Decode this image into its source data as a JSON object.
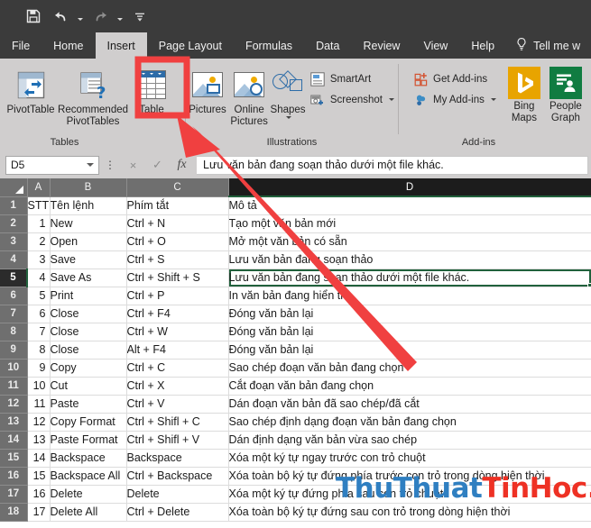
{
  "quick_access": {
    "buttons": [
      {
        "name": "save-icon",
        "label": "Save"
      },
      {
        "name": "undo-icon",
        "label": "Undo"
      },
      {
        "name": "redo-icon",
        "label": "Redo"
      },
      {
        "name": "customize-qat-icon",
        "label": "Customize Quick Access Toolbar"
      }
    ]
  },
  "ribbon": {
    "tabs": [
      {
        "label": "File",
        "active": false
      },
      {
        "label": "Home",
        "active": false
      },
      {
        "label": "Insert",
        "active": true
      },
      {
        "label": "Page Layout",
        "active": false
      },
      {
        "label": "Formulas",
        "active": false
      },
      {
        "label": "Data",
        "active": false
      },
      {
        "label": "Review",
        "active": false
      },
      {
        "label": "View",
        "active": false
      },
      {
        "label": "Help",
        "active": false
      }
    ],
    "tell_me": "Tell me w",
    "groups": [
      {
        "label": "Tables",
        "buttons": [
          {
            "label": "PivotTable",
            "icon": "pivot-table-icon"
          },
          {
            "label": "Recommended PivotTables",
            "icon": "recommended-pivottables-icon"
          },
          {
            "label": "Table",
            "icon": "table-icon",
            "highlighted": true
          }
        ]
      },
      {
        "label": "Illustrations",
        "buttons": [
          {
            "label": "Pictures",
            "icon": "pictures-icon"
          },
          {
            "label": "Online Pictures",
            "icon": "online-pictures-icon"
          },
          {
            "label": "Shapes",
            "icon": "shapes-icon"
          },
          {
            "label": "SmartArt",
            "icon": "smartart-icon"
          },
          {
            "label": "Screenshot",
            "icon": "screenshot-icon"
          }
        ]
      },
      {
        "label": "Add-ins",
        "buttons": [
          {
            "label": "Get Add-ins",
            "icon": "get-addins-icon"
          },
          {
            "label": "My Add-ins",
            "icon": "my-addins-icon"
          },
          {
            "label": "Bing Maps",
            "icon": "bing-maps-icon"
          },
          {
            "label": "People Graph",
            "icon": "people-graph-icon"
          }
        ]
      }
    ]
  },
  "formula_bar": {
    "name_box": "D5",
    "cancel_label": "×",
    "enter_label": "✓",
    "fx_label": "fx",
    "content": "Lưu văn bản đang soạn thảo dưới một file khác."
  },
  "sheet": {
    "columns": [
      "A",
      "B",
      "C",
      "D"
    ],
    "active_column": "D",
    "active_row": 5,
    "active_cell": "D5",
    "rows": [
      {
        "n": 1,
        "a": "STT",
        "b": "Tên lệnh",
        "c": "Phím tắt",
        "d": "Mô tả"
      },
      {
        "n": 2,
        "a": "1",
        "b": "New",
        "c": "Ctrl + N",
        "d": "Tạo một văn bản mới"
      },
      {
        "n": 3,
        "a": "2",
        "b": "Open",
        "c": "Ctrl + O",
        "d": "Mở một văn bản có sẵn"
      },
      {
        "n": 4,
        "a": "3",
        "b": "Save",
        "c": "Ctrl + S",
        "d": "Lưu văn bản đang soạn thảo"
      },
      {
        "n": 5,
        "a": "4",
        "b": "Save As",
        "c": "Ctrl + Shift + S",
        "d": "Lưu văn bản đang soạn thảo dưới một file khác."
      },
      {
        "n": 6,
        "a": "5",
        "b": "Print",
        "c": "Ctrl + P",
        "d": "In văn bản đang hiển thị"
      },
      {
        "n": 7,
        "a": "6",
        "b": "Close",
        "c": "Ctrl + F4",
        "d": "Đóng văn bản lại"
      },
      {
        "n": 8,
        "a": "7",
        "b": "Close",
        "c": "Ctrl + W",
        "d": "Đóng văn bản lại"
      },
      {
        "n": 9,
        "a": "8",
        "b": "Close",
        "c": "Alt + F4",
        "d": "Đóng văn bản lại"
      },
      {
        "n": 10,
        "a": "9",
        "b": "Copy",
        "c": "Ctrl + C",
        "d": "Sao chép đoạn văn bản đang chọn"
      },
      {
        "n": 11,
        "a": "10",
        "b": "Cut",
        "c": "Ctrl + X",
        "d": "Cắt đoạn văn bản đang chọn"
      },
      {
        "n": 12,
        "a": "11",
        "b": "Paste",
        "c": "Ctrl + V",
        "d": "Dán đoạn văn bản đã sao chép/đã cắt"
      },
      {
        "n": 13,
        "a": "12",
        "b": "Copy Format",
        "c": "Ctrl + Shifl + C",
        "d": "Sao chép định dạng đoạn văn bản đang chọn"
      },
      {
        "n": 14,
        "a": "13",
        "b": "Paste Format",
        "c": "Ctrl + Shifl + V",
        "d": "Dán định dạng văn bản vừa sao chép"
      },
      {
        "n": 15,
        "a": "14",
        "b": "Backspace",
        "c": "Backspace",
        "d": "Xóa một ký tự ngay trước con trỏ chuột"
      },
      {
        "n": 16,
        "a": "15",
        "b": "Backspace All",
        "c": "Ctrl + Backspace",
        "d": "Xóa toàn bộ ký tự đứng phía trước con trỏ trong dòng hiện thời"
      },
      {
        "n": 17,
        "a": "16",
        "b": "Delete",
        "c": "Delete",
        "d": "Xóa một ký tự đứng phía sau con trỏ chuột"
      },
      {
        "n": 18,
        "a": "17",
        "b": "Delete All",
        "c": "Ctrl + Delete",
        "d": "Xóa toàn bộ ký tự đứng sau con trỏ trong dòng hiện thời"
      }
    ]
  },
  "watermark": {
    "part1": "ThuThuat",
    "part2": "TinHoc.vn",
    "color1": "#2f7fc1",
    "color2": "#ee3124"
  },
  "annotation": {
    "highlight_target": "Table",
    "arrow_color": "#f04040",
    "highlight_color": "#f04040"
  }
}
